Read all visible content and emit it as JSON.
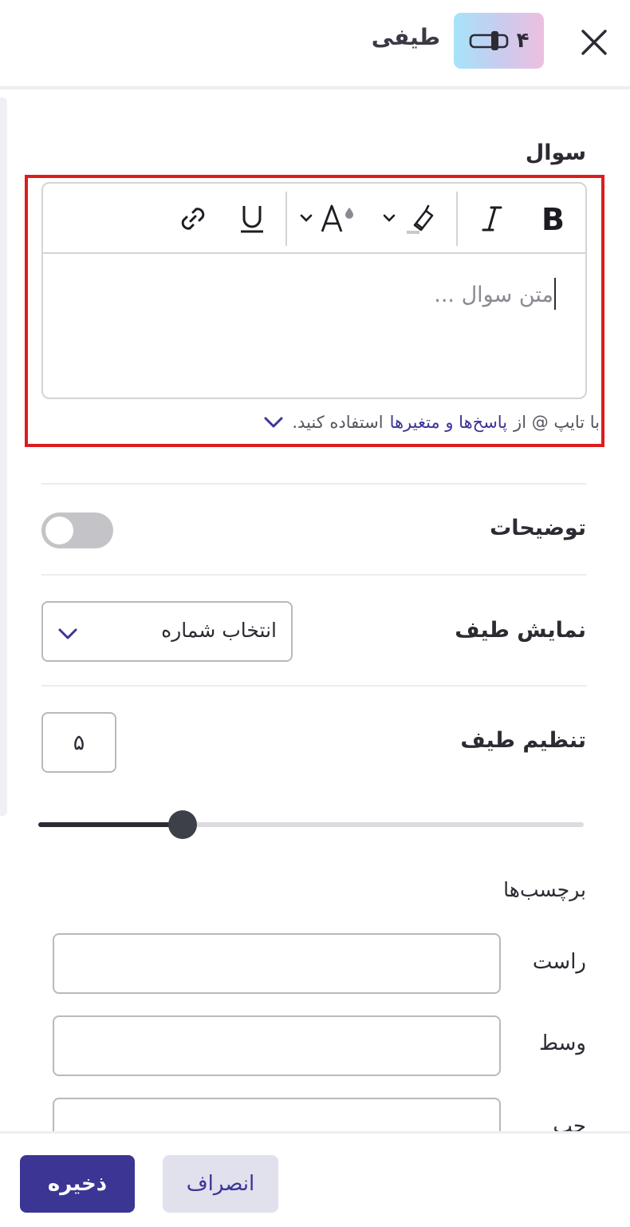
{
  "header": {
    "title": "طیفی",
    "question_number": "۴",
    "close_icon": "close-icon",
    "type_icon": "slider-icon",
    "badge_gradient": [
      "#a6e4fa",
      "#eebfdf"
    ]
  },
  "question": {
    "label": "سوال",
    "placeholder": "متن سوال ...",
    "toolbar": [
      "bold-icon",
      "italic-icon",
      "highlight-icon",
      "text-color-icon",
      "underline-icon",
      "link-icon"
    ],
    "hint_prefix": "با تایپ @ از",
    "hint_link": "پاسخ‌ها و متغیرها",
    "hint_suffix": "استفاده کنید."
  },
  "description": {
    "label": "توضیحات",
    "enabled": false
  },
  "display": {
    "label": "نمایش طیف",
    "selected": "انتخاب شماره"
  },
  "range": {
    "label": "تنظیم طیف",
    "value": "۵",
    "level": 5,
    "max": 10
  },
  "labels": {
    "title": "برچسب‌ها",
    "items": [
      {
        "label": "راست",
        "value": ""
      },
      {
        "label": "وسط",
        "value": ""
      },
      {
        "label": "چپ",
        "value": ""
      }
    ]
  },
  "footer": {
    "save": "ذخیره",
    "cancel": "انصراف"
  },
  "colors": {
    "primary": "#3b3594",
    "highlight_border": "#dd1c1c"
  }
}
